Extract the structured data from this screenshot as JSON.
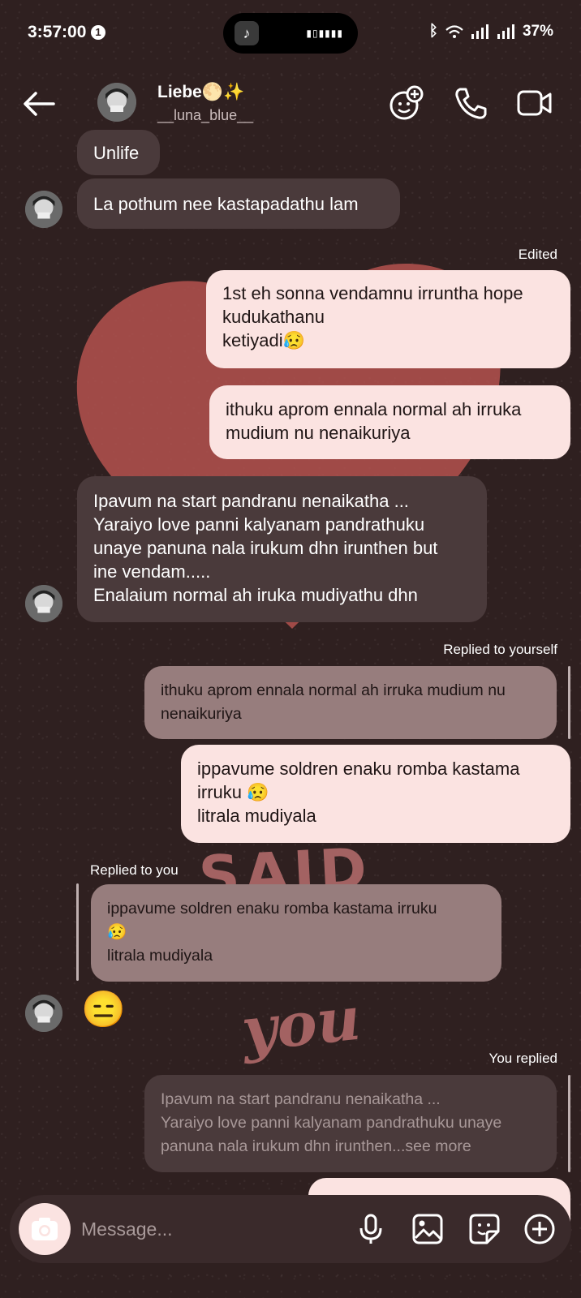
{
  "status": {
    "time": "3:57:00",
    "notif_count": "1",
    "battery": "37%"
  },
  "header": {
    "name": "Liebe🌕✨",
    "username": "__luna_blue__"
  },
  "messages": {
    "m1": "Unlife",
    "m2": "La pothum nee kastapadathu lam",
    "m3_meta": "Edited",
    "m3": "1st eh sonna vendamnu irruntha hope\nkudukathanu\nketiyadi😥",
    "m4": "ithuku aprom ennala normal ah irruka\nmudium nu nenaikuriya",
    "m5": "Ipavum na start pandranu nenaikatha ...\nYaraiyo love panni kalyanam pandrathuku\nunaye panuna nala irukum dhn irunthen but\nine vendam.....\nEnalaium normal ah iruka mudiyathu dhn",
    "m6_meta": "Replied to yourself",
    "m6_quote": "ithuku aprom ennala normal ah irruka mudium nu\nnenaikuriya",
    "m6": "ippavume soldren enaku romba kastama\nirruku 😥\nlitrala mudiyala",
    "m7_meta": "Replied to you",
    "m7_quote": "ippavume soldren enaku romba kastama irruku\n😥\nlitrala mudiyala",
    "m7": "😑",
    "m8_meta": "You replied",
    "m8_quote": "Ipavum na start pandranu nenaikatha ...\nYaraiyo love panni kalyanam pandrathuku unaye\npanuna nala irukum dhn irunthen...see more"
  },
  "composer": {
    "placeholder": "Message..."
  },
  "background": {
    "word_said": "SAID",
    "word_you": "YOU"
  },
  "colors": {
    "background": "#2f2020",
    "bubble_them": "#4a3a3b",
    "bubble_me": "#fbe3e1",
    "bubble_reply": "#977d7d",
    "heart": "#b4524f"
  }
}
